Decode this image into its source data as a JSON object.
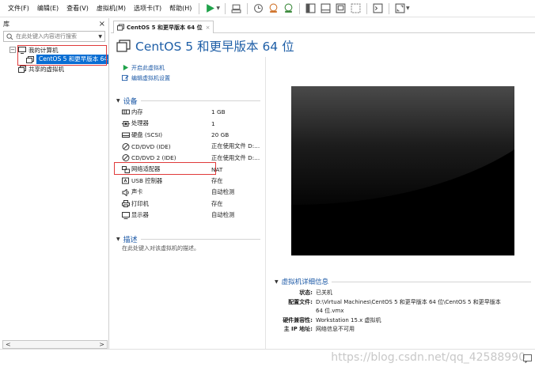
{
  "menu": {
    "file": "文件(F)",
    "edit": "编辑(E)",
    "view": "查看(V)",
    "vm": "虚拟机(M)",
    "tabs": "选项卡(T)",
    "help": "帮助(H)"
  },
  "library": {
    "title": "库",
    "close": "×",
    "search_placeholder": "在此处键入内容进行搜索",
    "my_computer": "我的计算机",
    "vm_item": "CentOS 5 和更早版本 64",
    "shared": "共享的虚拟机",
    "scroll_left": "<",
    "scroll_right": ">"
  },
  "tab": {
    "label": "CentOS 5 和更早版本 64 位",
    "close": "×"
  },
  "vm": {
    "title": "CentOS 5 和更早版本 64 位",
    "power_on": "开启此虚拟机",
    "edit_settings": "编辑虚拟机设置"
  },
  "devices": {
    "heading": "设备",
    "rows": [
      {
        "name": "内存",
        "value": "1 GB",
        "icon": "memory-icon"
      },
      {
        "name": "处理器",
        "value": "1",
        "icon": "processor-icon"
      },
      {
        "name": "硬盘 (SCSI)",
        "value": "20 GB",
        "icon": "harddisk-icon"
      },
      {
        "name": "CD/DVD (IDE)",
        "value": "正在使用文件 D:...",
        "icon": "cdrom-icon"
      },
      {
        "name": "CD/DVD 2 (IDE)",
        "value": "正在使用文件 D:...",
        "icon": "cdrom-icon"
      },
      {
        "name": "网络适配器",
        "value": "NAT",
        "icon": "network-adapter-icon"
      },
      {
        "name": "USB 控制器",
        "value": "存在",
        "icon": "usb-icon"
      },
      {
        "name": "声卡",
        "value": "自动检测",
        "icon": "sound-icon"
      },
      {
        "name": "打印机",
        "value": "存在",
        "icon": "printer-icon"
      },
      {
        "name": "显示器",
        "value": "自动检测",
        "icon": "display-icon"
      }
    ]
  },
  "description": {
    "heading": "描述",
    "placeholder": "在此处键入对该虚拟机的描述。"
  },
  "details": {
    "heading": "虚拟机详细信息",
    "status_key": "状态:",
    "status_val": "已关机",
    "config_key": "配置文件:",
    "config_val_1": "D:\\Virtual Machines\\CentOS 5 和更早版本 64 位\\CentOS 5 和更早版本",
    "config_val_2": "64 位.vmx",
    "compat_key": "硬件兼容性:",
    "compat_val": "Workstation 15.x 虚拟机",
    "ip_key": "主 IP 地址:",
    "ip_val": "网络信息不可用"
  },
  "watermark": "https://blog.csdn.net/qq_42588990",
  "colors": {
    "accent": "#1b58a6",
    "selection": "#0a6ed3",
    "highlight_box": "#e03a3a",
    "power_green": "#1fa24a"
  }
}
